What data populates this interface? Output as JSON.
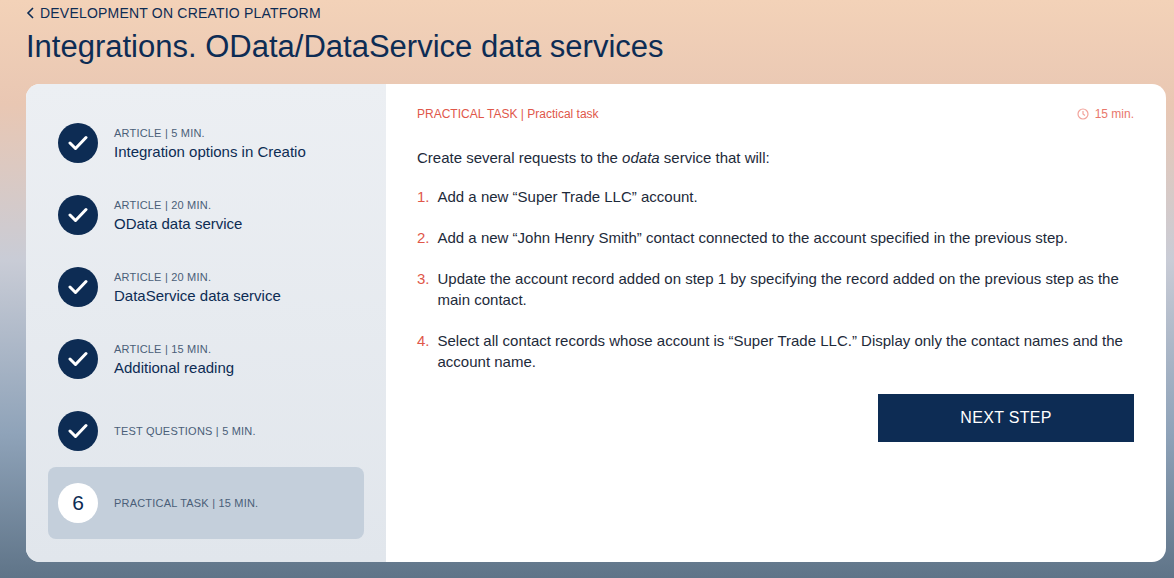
{
  "breadcrumb": {
    "label": "DEVELOPMENT ON CREATIO PLATFORM"
  },
  "page": {
    "title": "Integrations. OData/DataService data services"
  },
  "modules": [
    {
      "kind": "titled",
      "meta": "ARTICLE | 5 MIN.",
      "title": "Integration options in Creatio",
      "number": "1",
      "done": true,
      "selected": false
    },
    {
      "kind": "titled",
      "meta": "ARTICLE | 20 MIN.",
      "title": "OData data service",
      "number": "2",
      "done": true,
      "selected": false
    },
    {
      "kind": "titled",
      "meta": "ARTICLE | 20 MIN.",
      "title": "DataService data service",
      "number": "3",
      "done": true,
      "selected": false
    },
    {
      "kind": "titled",
      "meta": "ARTICLE | 15 MIN.",
      "title": "Additional reading",
      "number": "4",
      "done": true,
      "selected": false
    },
    {
      "kind": "meta-only",
      "meta": "TEST QUESTIONS | 5 MIN.",
      "title": "",
      "number": "5",
      "done": true,
      "selected": false
    },
    {
      "kind": "meta-only",
      "meta": "PRACTICAL TASK | 15 MIN.",
      "title": "",
      "number": "6",
      "done": false,
      "selected": true
    }
  ],
  "task": {
    "label": "PRACTICAL TASK | Practical task",
    "duration": "15 min.",
    "intro": [
      {
        "text": "Create several requests to the ",
        "italic": false
      },
      {
        "text": "odata",
        "italic": true
      },
      {
        "text": " service that will:",
        "italic": false
      }
    ],
    "steps": [
      {
        "number": "1.",
        "text": "Add a new “Super Trade LLC” account."
      },
      {
        "number": "2.",
        "text": "Add a new “John Henry Smith” contact connected to the account specified in the previous step."
      },
      {
        "number": "3.",
        "text": "Update the account record added on step 1 by specifying the record added on the previous step as the main contact."
      },
      {
        "number": "4.",
        "text": "Select all contact records whose account is “Super Trade LLC.” Display only the contact names and the account name."
      }
    ],
    "button": "NEXT STEP"
  }
}
